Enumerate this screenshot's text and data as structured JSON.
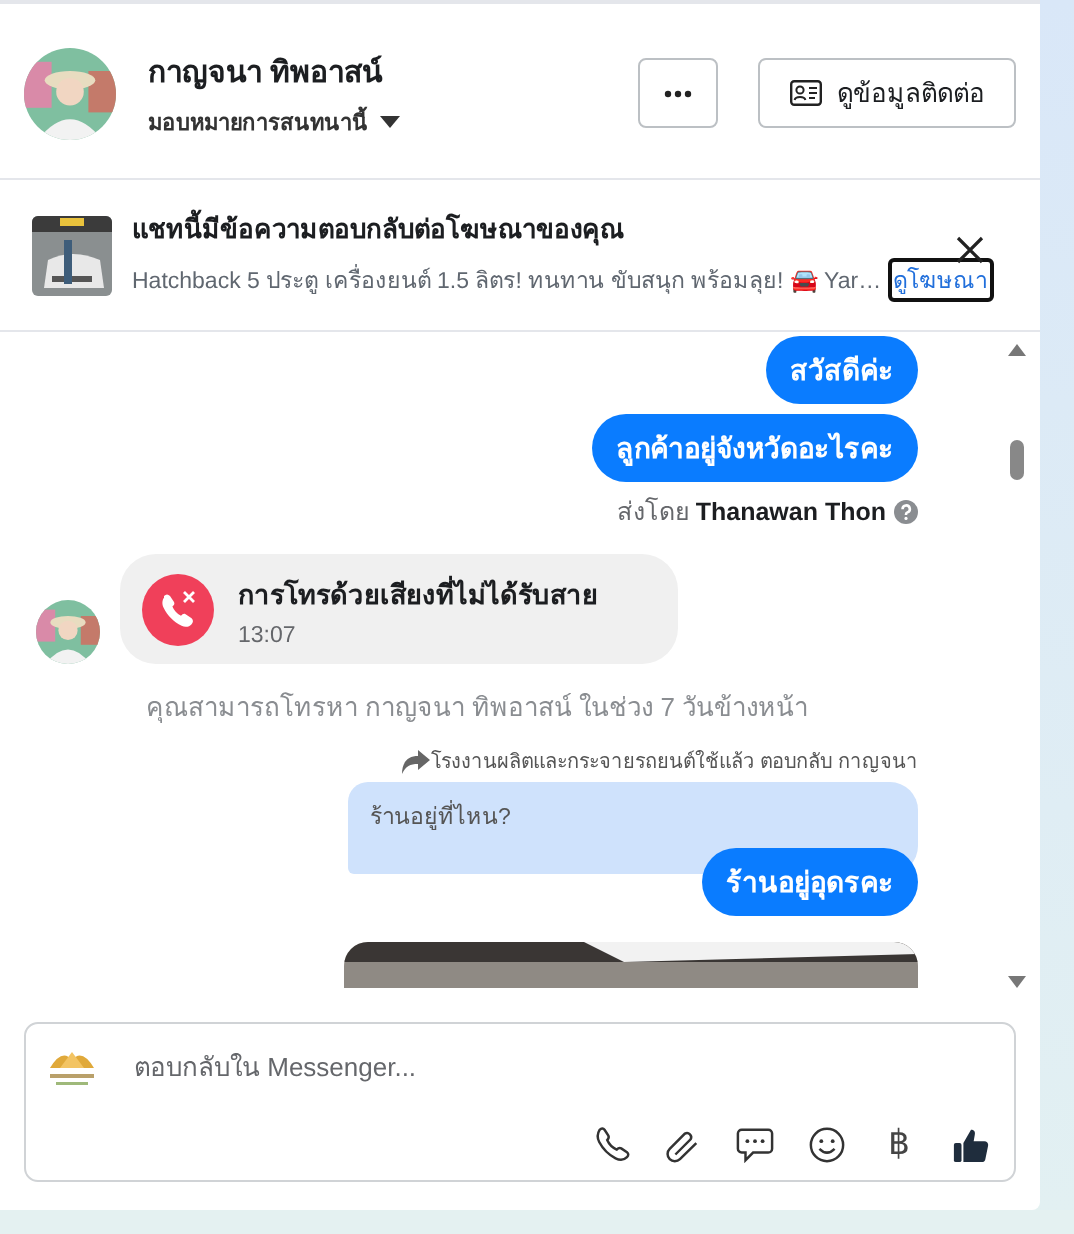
{
  "header": {
    "name": "กาญจนา ทิพอาสน์",
    "assign_label": "มอบหมายการสนทนานี้",
    "contact_button": "ดูข้อมูลติดต่อ"
  },
  "ad_banner": {
    "title": "แชทนี้มีข้อความตอบกลับต่อโฆษณาของคุณ",
    "text": "Hatchback 5 ประตู เครื่องยนต์ 1.5 ลิตร! ทนทาน ขับสนุก พร้อมลุย! 🚘 Yar…",
    "link": "ดูโฆษณา"
  },
  "messages": [
    {
      "kind": "outgoing",
      "text": "สวัสดีค่ะ"
    },
    {
      "kind": "outgoing",
      "text": "ลูกค้าอยู่จังหวัดอะไรคะ"
    },
    {
      "kind": "sent_by",
      "text": "ส่งโดย",
      "name": "Thanawan Thon"
    },
    {
      "kind": "missed_call",
      "title": "การโทรด้วยเสียงที่ไม่ได้รับสาย",
      "time": "13:07"
    },
    {
      "kind": "info",
      "text": "คุณสามารถโทรหา กาญจนา ทิพอาสน์ ในช่วง 7 วันข้างหน้า"
    },
    {
      "kind": "reply_context",
      "text": "โรงงานผลิตและกระจายรถยนต์ใช้แล้ว ตอบกลับ กาญจนา"
    },
    {
      "kind": "quoted",
      "text": "ร้านอยู่ที่ไหน?"
    },
    {
      "kind": "outgoing_reply",
      "text": "ร้านอยู่อุดรคะ"
    },
    {
      "kind": "picture"
    }
  ],
  "composer": {
    "placeholder": "ตอบกลับใน Messenger...",
    "currency": "฿"
  }
}
